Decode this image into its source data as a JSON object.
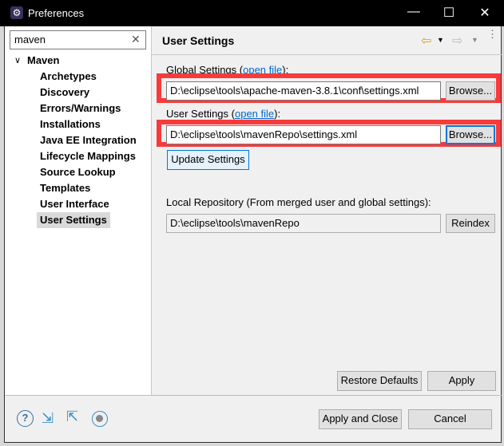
{
  "window": {
    "title": "Preferences",
    "icon": "eclipse-gear-icon",
    "minimize": "—",
    "maximize": "☐",
    "close": "✕"
  },
  "sidebar": {
    "search_value": "maven",
    "tree": {
      "root": "Maven",
      "items": [
        "Archetypes",
        "Discovery",
        "Errors/Warnings",
        "Installations",
        "Java EE Integration",
        "Lifecycle Mappings",
        "Source Lookup",
        "Templates",
        "User Interface",
        "User Settings"
      ],
      "selected": "User Settings"
    }
  },
  "page": {
    "title": "User Settings",
    "global_label": "Global Settings (",
    "global_link": "open file",
    "global_suffix": "):",
    "global_value": "D:\\eclipse\\tools\\apache-maven-3.8.1\\conf\\settings.xml",
    "user_label": "User Settings (",
    "user_link": "open file",
    "user_suffix": "):",
    "user_value": "D:\\eclipse\\tools\\mavenRepo\\settings.xml",
    "browse": "Browse...",
    "update": "Update Settings",
    "local_label": "Local Repository (From merged user and global settings):",
    "local_value": "D:\\eclipse\\tools\\mavenRepo",
    "reindex": "Reindex",
    "restore": "Restore Defaults",
    "apply": "Apply"
  },
  "footer": {
    "apply_close": "Apply and Close",
    "cancel": "Cancel"
  },
  "colors": {
    "highlight": "#f93a3a",
    "link": "#0066cc",
    "back_arrow": "#e0a020"
  }
}
